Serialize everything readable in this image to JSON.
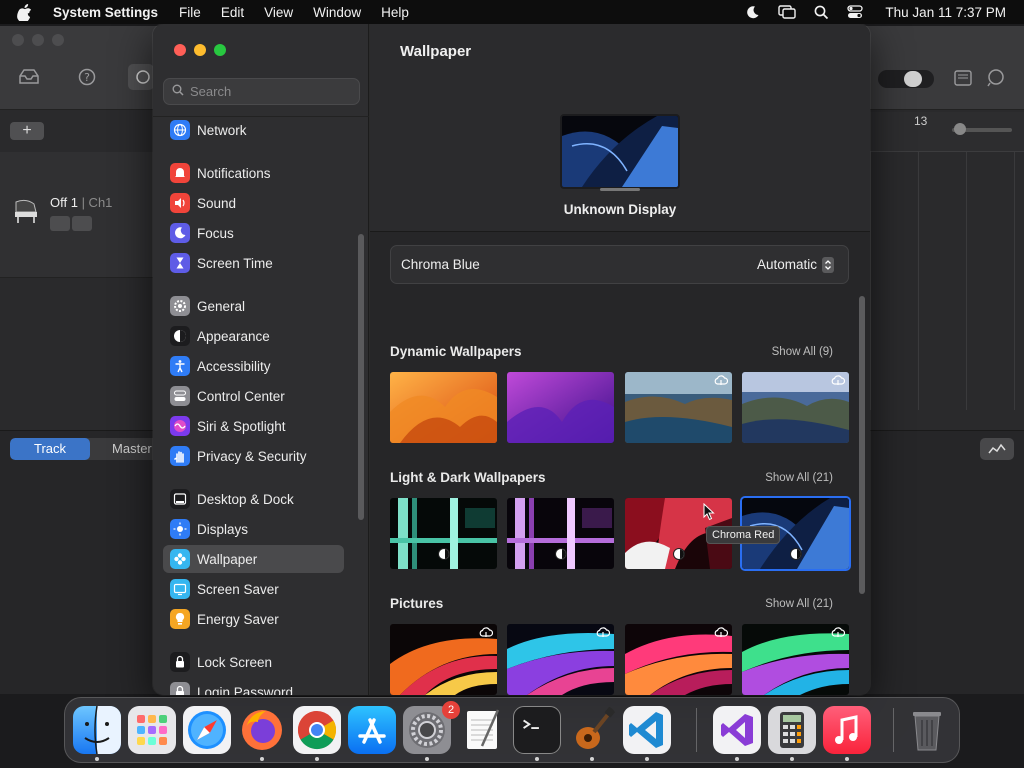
{
  "menubar": {
    "app_name": "System Settings",
    "menus": [
      "File",
      "Edit",
      "View",
      "Window",
      "Help"
    ],
    "clock": "Thu Jan 11  7:37 PM"
  },
  "background_app": {
    "track_name": "Off 1",
    "track_channel": " | Ch1",
    "ruler_number": "13",
    "tabs": [
      "Track",
      "Master"
    ],
    "add_label": "+"
  },
  "settings": {
    "search_placeholder": "Search",
    "sidebar": [
      {
        "label": "Network",
        "icon": "globe-icon",
        "color": "#2f7cf6"
      },
      {
        "label": "Notifications",
        "icon": "bell-icon",
        "color": "#f0443a"
      },
      {
        "label": "Sound",
        "icon": "speaker-icon",
        "color": "#f0443a"
      },
      {
        "label": "Focus",
        "icon": "moon-icon",
        "color": "#5e5ce6"
      },
      {
        "label": "Screen Time",
        "icon": "hourglass-icon",
        "color": "#5e5ce6"
      },
      {
        "label": "General",
        "icon": "gear-icon",
        "color": "#8e8e93"
      },
      {
        "label": "Appearance",
        "icon": "appearance-icon",
        "color": "#1c1c1e"
      },
      {
        "label": "Accessibility",
        "icon": "accessibility-icon",
        "color": "#2f7cf6"
      },
      {
        "label": "Control Center",
        "icon": "control-center-icon",
        "color": "#8e8e93"
      },
      {
        "label": "Siri & Spotlight",
        "icon": "siri-icon",
        "color": "#7c3aed"
      },
      {
        "label": "Privacy & Security",
        "icon": "hand-icon",
        "color": "#2f7cf6"
      },
      {
        "label": "Desktop & Dock",
        "icon": "dock-icon",
        "color": "#1c1c1e"
      },
      {
        "label": "Displays",
        "icon": "sun-icon",
        "color": "#2f7cf6"
      },
      {
        "label": "Wallpaper",
        "icon": "wallpaper-icon",
        "color": "#35b6f0"
      },
      {
        "label": "Screen Saver",
        "icon": "screensaver-icon",
        "color": "#35b6f0"
      },
      {
        "label": "Energy Saver",
        "icon": "bulb-icon",
        "color": "#f5a623"
      },
      {
        "label": "Lock Screen",
        "icon": "lock-icon",
        "color": "#1c1c1e"
      },
      {
        "label": "Login Password",
        "icon": "lock-icon",
        "color": "#8e8e93"
      }
    ],
    "selected_item": "Wallpaper",
    "content": {
      "title": "Wallpaper",
      "display_name": "Unknown Display",
      "wallpaper_name": "Chroma Blue",
      "mode_value": "Automatic",
      "sections": [
        {
          "title": "Dynamic Wallpapers",
          "show_all": "Show All (9)"
        },
        {
          "title": "Light & Dark Wallpapers",
          "show_all": "Show All (21)"
        },
        {
          "title": "Pictures",
          "show_all": "Show All (21)"
        }
      ],
      "tooltip": "Chroma Red"
    }
  },
  "dock": {
    "apps": [
      "Finder",
      "Launchpad",
      "Safari",
      "Firefox",
      "Chrome",
      "App Store",
      "System Settings",
      "TextEdit",
      "Terminal",
      "GarageBand",
      "Visual Studio Code",
      "Visual Studio",
      "Calculator",
      "Music",
      "Trash"
    ],
    "settings_badge": "2"
  }
}
